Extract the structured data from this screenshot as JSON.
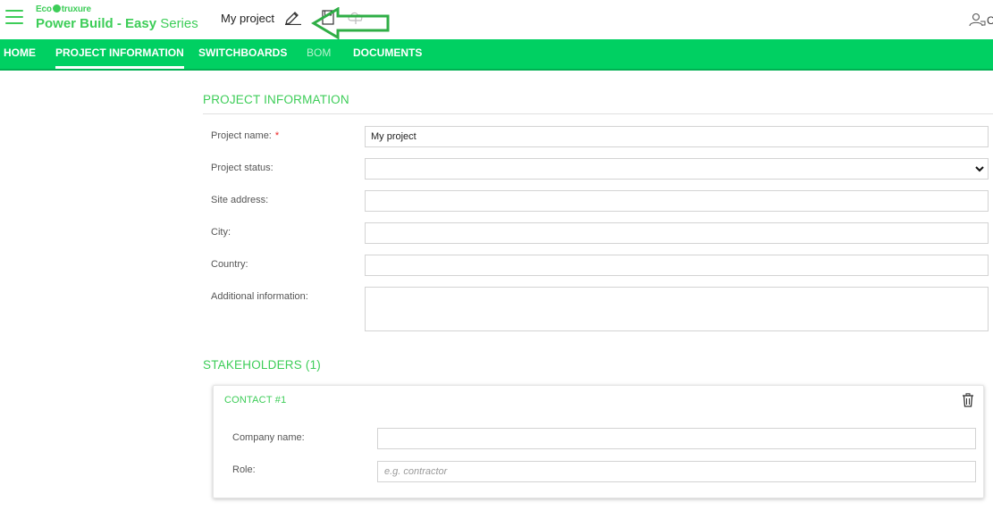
{
  "header": {
    "brand_top": "Eco",
    "brand_top_tail": "truxure",
    "brand_main_bold": "Power Build - Easy",
    "brand_main_light": "Series",
    "project_title": "My project",
    "user_initial": "C"
  },
  "nav": {
    "items": [
      {
        "label": "HOME"
      },
      {
        "label": "PROJECT INFORMATION"
      },
      {
        "label": "SWITCHBOARDS"
      },
      {
        "label": "BOM"
      },
      {
        "label": "DOCUMENTS"
      }
    ]
  },
  "project_info": {
    "title": "PROJECT INFORMATION",
    "fields": [
      {
        "label": "Project name:",
        "required": "*",
        "value": "My project"
      },
      {
        "label": "Project status:",
        "value": ""
      },
      {
        "label": "Site address:",
        "value": ""
      },
      {
        "label": "City:",
        "value": ""
      },
      {
        "label": "Country:",
        "value": ""
      },
      {
        "label": "Additional information:",
        "value": ""
      }
    ]
  },
  "stakeholders": {
    "title": "STAKEHOLDERS (1)",
    "contacts": [
      {
        "title": "CONTACT #1",
        "company_label": "Company name:",
        "company_value": "",
        "role_label": "Role:",
        "role_placeholder": "e.g. contractor"
      }
    ]
  },
  "colors": {
    "brand_green": "#3dcd58",
    "nav_green": "#00d062",
    "annotation_green": "#2fae46"
  },
  "icons": [
    "hamburger-menu-icon",
    "pencil-edit-icon",
    "save-icon",
    "cloud-upload-icon",
    "user-icon",
    "chevron-down-icon",
    "trash-icon"
  ]
}
